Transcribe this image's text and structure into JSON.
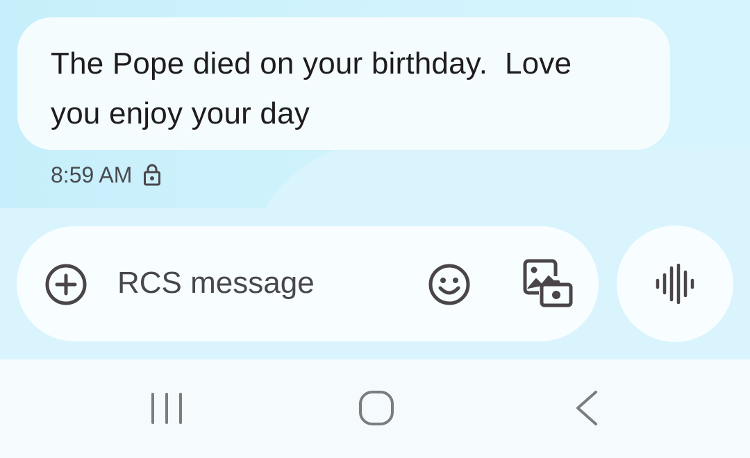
{
  "message": {
    "text": "The Pope died on your birthday.  Love\nyou enjoy your day",
    "time": "8:59 AM",
    "status_icon": "lock-icon"
  },
  "composer": {
    "placeholder": "RCS message",
    "value": "",
    "add_icon": "plus-circle-icon",
    "emoji_icon": "emoji-icon",
    "gallery_icon": "gallery-camera-icon",
    "voice_icon": "voice-waveform-icon"
  },
  "navbar": {
    "recents_icon": "recents-icon",
    "home_icon": "home-icon",
    "back_icon": "back-icon"
  },
  "colors": {
    "background": "#d8f3fc",
    "bubble": "#f5fcfe",
    "text": "#1f1c1f",
    "icon": "#4a4548",
    "navbar": "#f5fbfd"
  }
}
